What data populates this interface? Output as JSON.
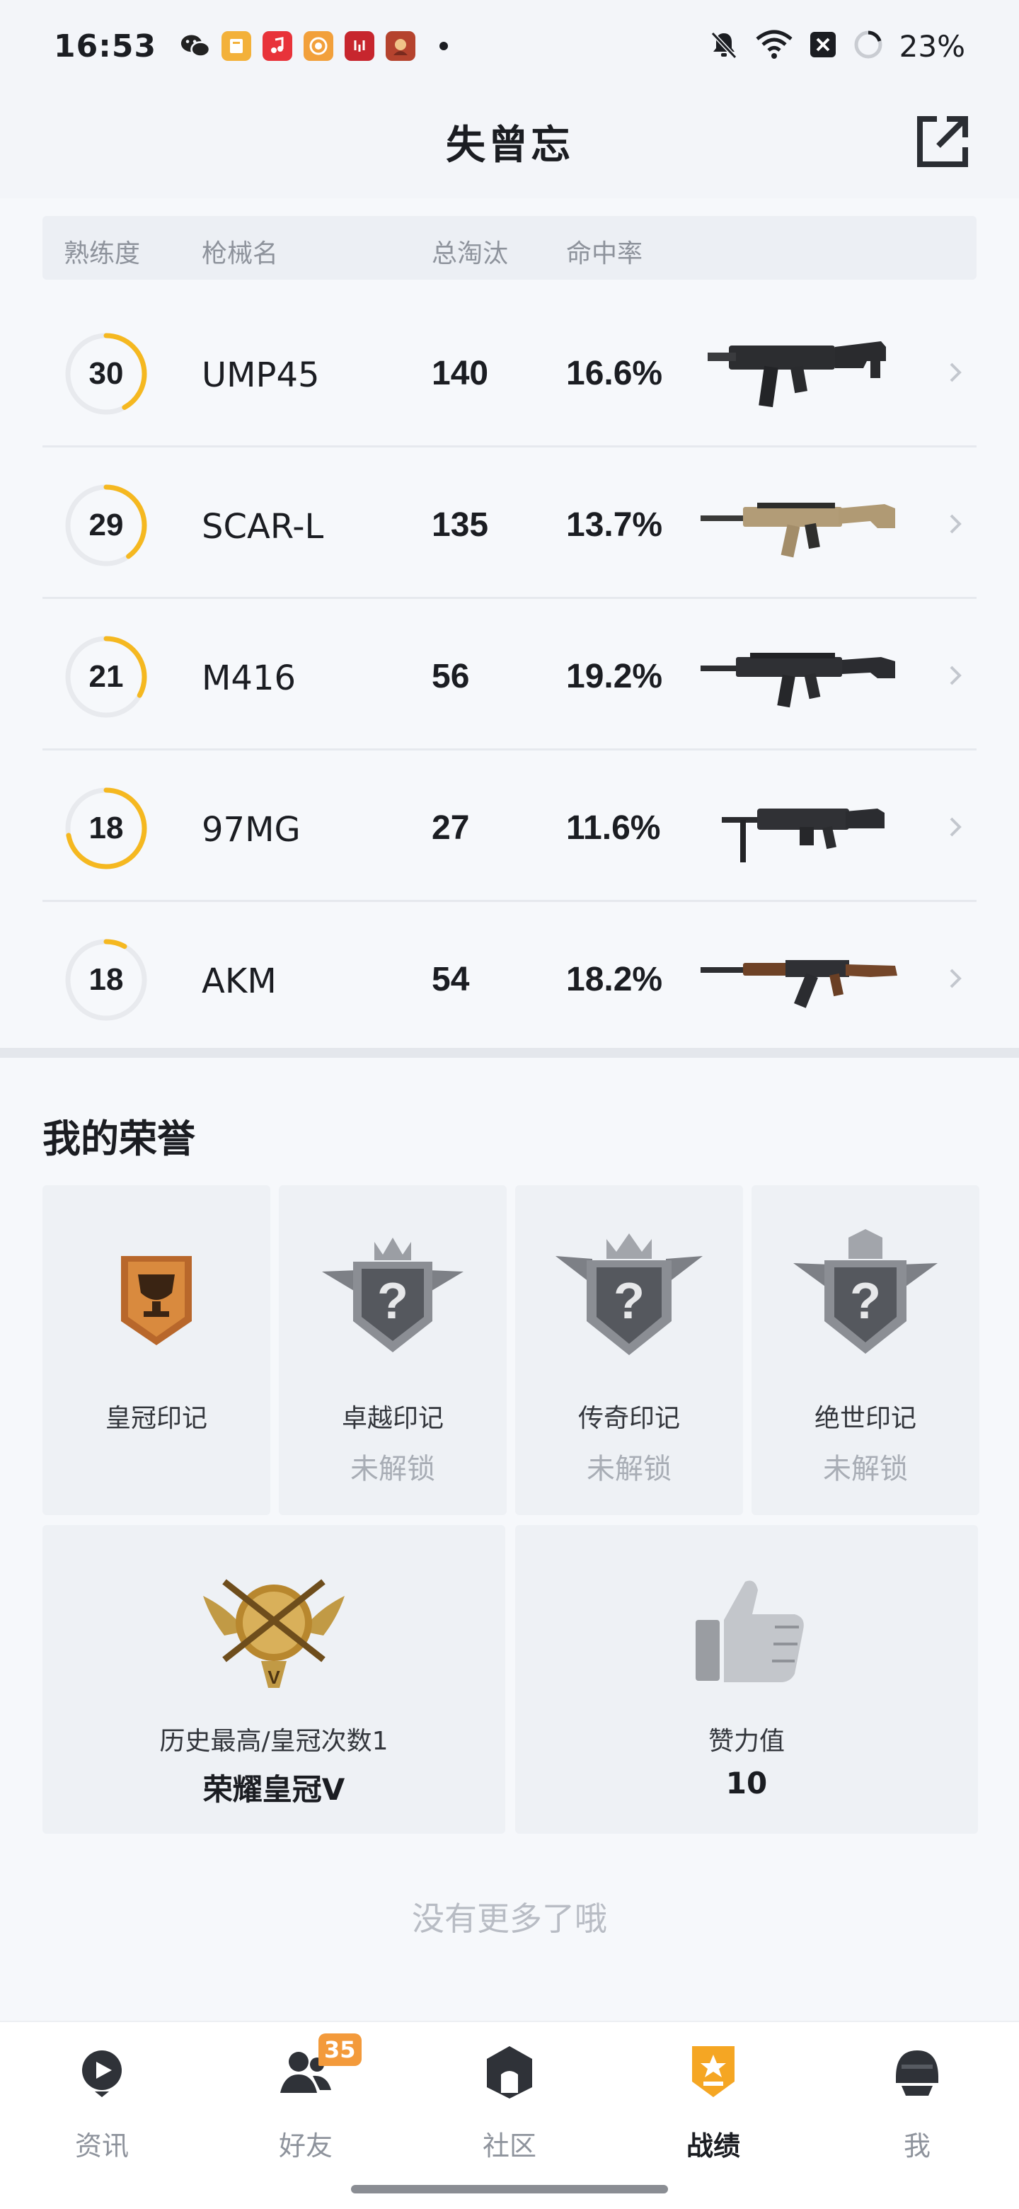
{
  "status_bar": {
    "time": "16:53",
    "battery_percent": "23%",
    "icons": [
      "wechat-icon",
      "books-icon",
      "music-icon",
      "target-icon",
      "red-app-icon",
      "game-icon",
      "mute-icon",
      "wifi-icon",
      "close-box-icon",
      "battery-ring-icon"
    ]
  },
  "header": {
    "title": "失曾忘"
  },
  "weapons": {
    "columns": [
      "熟练度",
      "枪械名",
      "总淘汰",
      "命中率"
    ],
    "rows": [
      {
        "level": "30",
        "level_progress": 0.42,
        "name": "UMP45",
        "kills": "140",
        "hit_rate": "16.6%"
      },
      {
        "level": "29",
        "level_progress": 0.4,
        "name": "SCAR-L",
        "kills": "135",
        "hit_rate": "13.7%"
      },
      {
        "level": "21",
        "level_progress": 0.33,
        "name": "M416",
        "kills": "56",
        "hit_rate": "19.2%"
      },
      {
        "level": "18",
        "level_progress": 0.72,
        "name": "97MG",
        "kills": "27",
        "hit_rate": "11.6%"
      },
      {
        "level": "18",
        "level_progress": 0.08,
        "name": "AKM",
        "kills": "54",
        "hit_rate": "18.2%"
      }
    ],
    "ring_color": "#f5b820",
    "ring_track_color": "#e8eaee"
  },
  "honors": {
    "title": "我的荣誉",
    "badges": [
      {
        "name": "皇冠印记",
        "status": ""
      },
      {
        "name": "卓越印记",
        "status": "未解锁"
      },
      {
        "name": "传奇印记",
        "status": "未解锁"
      },
      {
        "name": "绝世印记",
        "status": "未解锁"
      }
    ],
    "highest": {
      "label": "历史最高/皇冠次数1",
      "value": "荣耀皇冠V"
    },
    "likes": {
      "label": "赞力值",
      "value": "10"
    },
    "end_text": "没有更多了哦"
  },
  "bottom_nav": {
    "items": [
      {
        "label": "资讯",
        "icon": "news-icon"
      },
      {
        "label": "好友",
        "icon": "friends-icon",
        "badge": "35"
      },
      {
        "label": "社区",
        "icon": "community-icon"
      },
      {
        "label": "战绩",
        "icon": "record-icon",
        "active": true
      },
      {
        "label": "我",
        "icon": "profile-icon"
      }
    ]
  }
}
